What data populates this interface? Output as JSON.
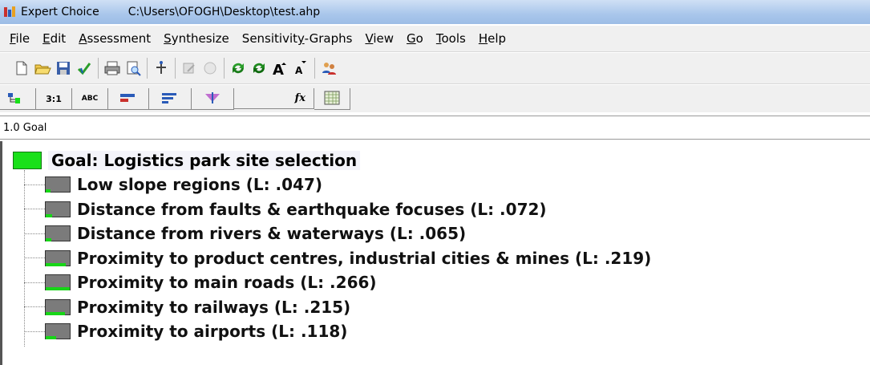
{
  "window": {
    "app_name": "Expert Choice",
    "file_path": "C:\\Users\\OFOGH\\Desktop\\test.ahp"
  },
  "menu": [
    {
      "key": "F",
      "rest": "ile"
    },
    {
      "key": "E",
      "rest": "dit"
    },
    {
      "key": "A",
      "rest": "ssessment"
    },
    {
      "key": "S",
      "rest": "ynthesize"
    },
    {
      "label_pre": "Sensitivit",
      "key": "y",
      "rest": "-Graphs"
    },
    {
      "key": "V",
      "rest": "iew"
    },
    {
      "key": "G",
      "rest": "o"
    },
    {
      "key": "T",
      "rest": "ools"
    },
    {
      "key": "H",
      "rest": "elp"
    }
  ],
  "tabs": [
    {
      "icon": "tree-view-icon"
    },
    {
      "label": "3:1"
    },
    {
      "label": "ABC"
    },
    {
      "icon": "bar-graph-icon"
    },
    {
      "icon": "priority-bars-icon"
    },
    {
      "icon": "sort-icon"
    },
    {
      "icon": "formula-icon",
      "label": "fx"
    },
    {
      "icon": "data-grid-icon"
    }
  ],
  "status": "1.0 Goal",
  "goal": {
    "label": "Goal: Logistics park site selection",
    "color": "#19e019"
  },
  "criteria": [
    {
      "label": "Low slope regions (L: .047)",
      "weight": 0.047
    },
    {
      "label": "Distance from faults & earthquake focuses (L: .072)",
      "weight": 0.072
    },
    {
      "label": "Distance from rivers & waterways (L: .065)",
      "weight": 0.065
    },
    {
      "label": "Proximity to product centres, industrial cities & mines (L: .219)",
      "weight": 0.219
    },
    {
      "label": "Proximity to main roads (L: .266)",
      "weight": 0.266
    },
    {
      "label": "Proximity to railways (L: .215)",
      "weight": 0.215
    },
    {
      "label": "Proximity to airports (L: .118)",
      "weight": 0.118
    }
  ]
}
